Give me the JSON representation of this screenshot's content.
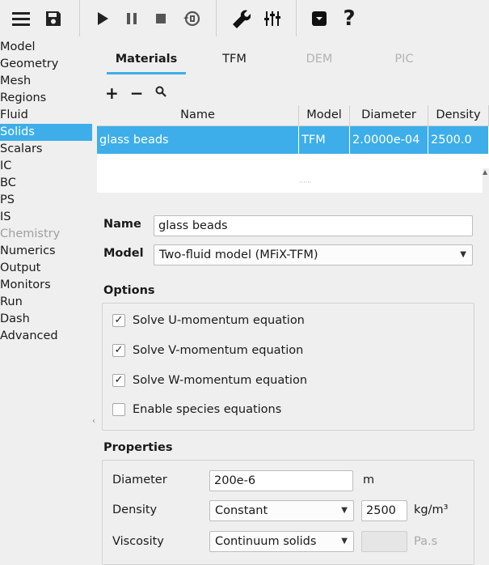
{
  "toolbar": {
    "icons": [
      "menu-icon",
      "save-icon",
      "play-icon",
      "pause-icon",
      "stop-icon",
      "reset-icon",
      "wrench-icon",
      "sliders-icon",
      "archive-icon",
      "help-icon"
    ]
  },
  "nav": {
    "items": [
      {
        "label": "Model",
        "state": "normal"
      },
      {
        "label": "Geometry",
        "state": "normal"
      },
      {
        "label": "Mesh",
        "state": "normal"
      },
      {
        "label": "Regions",
        "state": "normal"
      },
      {
        "label": "Fluid",
        "state": "normal"
      },
      {
        "label": "Solids",
        "state": "selected"
      },
      {
        "label": "Scalars",
        "state": "normal"
      },
      {
        "label": "IC",
        "state": "normal"
      },
      {
        "label": "BC",
        "state": "normal"
      },
      {
        "label": "PS",
        "state": "normal"
      },
      {
        "label": "IS",
        "state": "normal"
      },
      {
        "label": "Chemistry",
        "state": "disabled"
      },
      {
        "label": "Numerics",
        "state": "normal"
      },
      {
        "label": "Output",
        "state": "normal"
      },
      {
        "label": "Monitors",
        "state": "normal"
      },
      {
        "label": "Run",
        "state": "normal"
      },
      {
        "label": "Dash",
        "state": "normal"
      },
      {
        "label": "Advanced",
        "state": "normal"
      }
    ]
  },
  "tabs": [
    {
      "label": "Materials",
      "state": "active"
    },
    {
      "label": "TFM",
      "state": "normal"
    },
    {
      "label": "DEM",
      "state": "disabled"
    },
    {
      "label": "PIC",
      "state": "disabled"
    }
  ],
  "mini_tools": {
    "add": "+",
    "remove": "−"
  },
  "table": {
    "headers": [
      "Name",
      "Model",
      "Diameter",
      "Density"
    ],
    "rows": [
      [
        "glass beads",
        "TFM",
        "2.0000e-04",
        "2500.0"
      ]
    ]
  },
  "detail": {
    "name_label": "Name",
    "name_value": "glass beads",
    "model_label": "Model",
    "model_value": "Two-fluid model (MFiX-TFM)",
    "options_title": "Options",
    "options": [
      {
        "label": "Solve U-momentum equation",
        "checked": true
      },
      {
        "label": "Solve V-momentum equation",
        "checked": true
      },
      {
        "label": "Solve W-momentum equation",
        "checked": true
      },
      {
        "label": "Enable species equations",
        "checked": false
      }
    ],
    "properties_title": "Properties",
    "diameter_label": "Diameter",
    "diameter_value": "200e-6",
    "diameter_unit": "m",
    "density_label": "Density",
    "density_mode": "Constant",
    "density_value": "2500",
    "density_unit": "kg/m³",
    "viscosity_label": "Viscosity",
    "viscosity_mode": "Continuum solids",
    "viscosity_value": "",
    "viscosity_unit": "Pa.s"
  },
  "colors": {
    "accent": "#3daee9",
    "background": "#efefef",
    "disabled_text": "#a0a0a0"
  }
}
